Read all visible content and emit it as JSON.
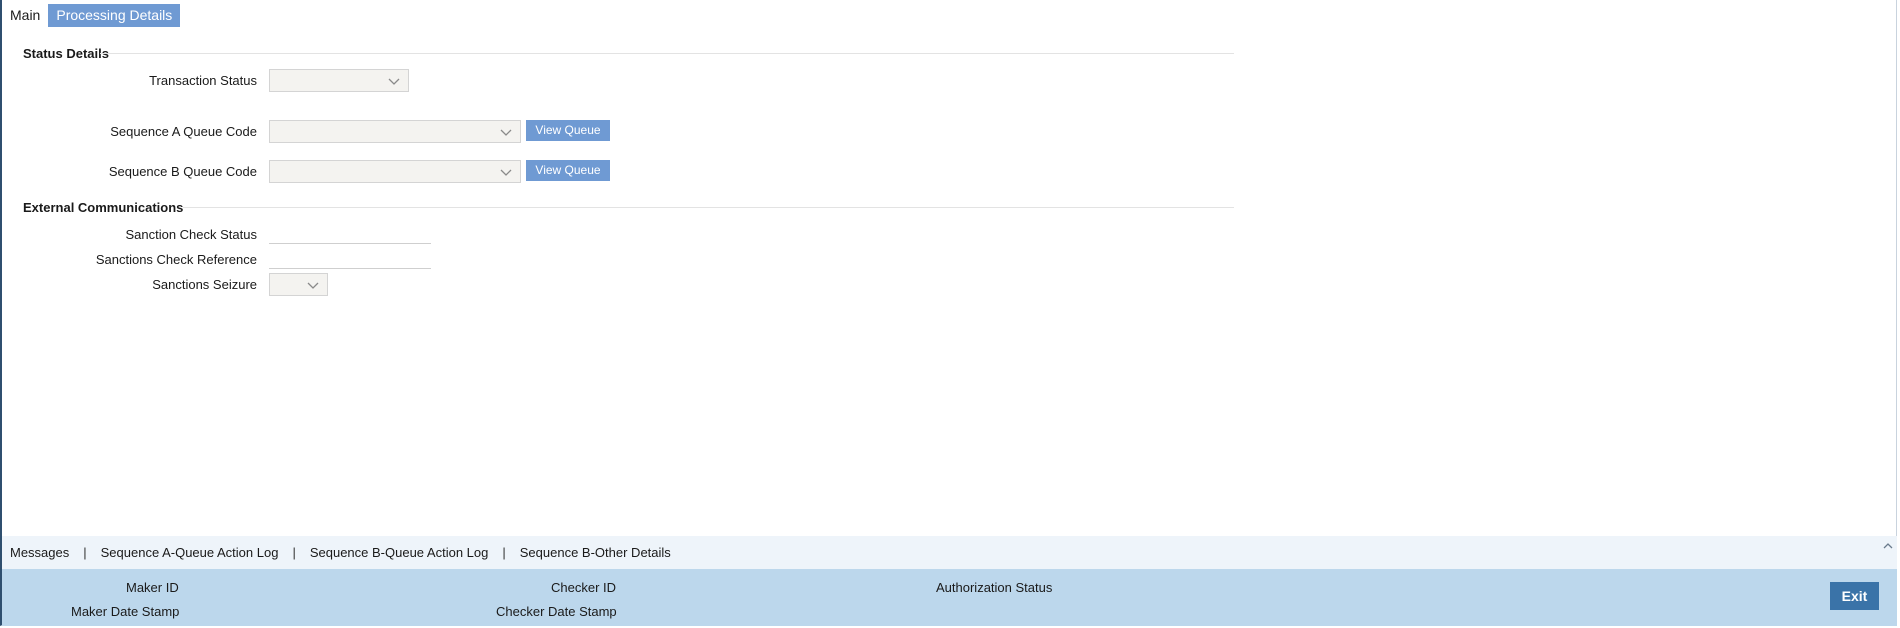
{
  "tabs": [
    {
      "label": "Main"
    },
    {
      "label": "Processing Details"
    }
  ],
  "status_details": {
    "title": "Status Details",
    "transaction_status": {
      "label": "Transaction Status",
      "value": ""
    },
    "sequence_a": {
      "label": "Sequence A Queue Code",
      "value": "",
      "button": "View Queue"
    },
    "sequence_b": {
      "label": "Sequence B Queue Code",
      "value": "",
      "button": "View Queue"
    }
  },
  "external_communications": {
    "title": "External Communications",
    "sanction_check_status": {
      "label": "Sanction Check Status",
      "value": ""
    },
    "sanctions_check_reference": {
      "label": "Sanctions Check Reference",
      "value": ""
    },
    "sanctions_seizure": {
      "label": "Sanctions Seizure",
      "value": ""
    }
  },
  "bottom_links": [
    {
      "label": "Messages"
    },
    {
      "label": "Sequence A-Queue Action Log"
    },
    {
      "label": "Sequence B-Queue Action Log"
    },
    {
      "label": "Sequence B-Other Details"
    }
  ],
  "link_separator": "|",
  "audit": {
    "maker_id": "Maker ID",
    "maker_date_stamp": "Maker Date Stamp",
    "checker_id": "Checker ID",
    "checker_date_stamp": "Checker Date Stamp",
    "authorization_status": "Authorization Status"
  },
  "exit_label": "Exit",
  "colors": {
    "accent": "#6f9ad3",
    "footer_bg": "#bcd7ec",
    "exit_bg": "#3a73a8",
    "linkbar_bg": "#eef4fa"
  }
}
